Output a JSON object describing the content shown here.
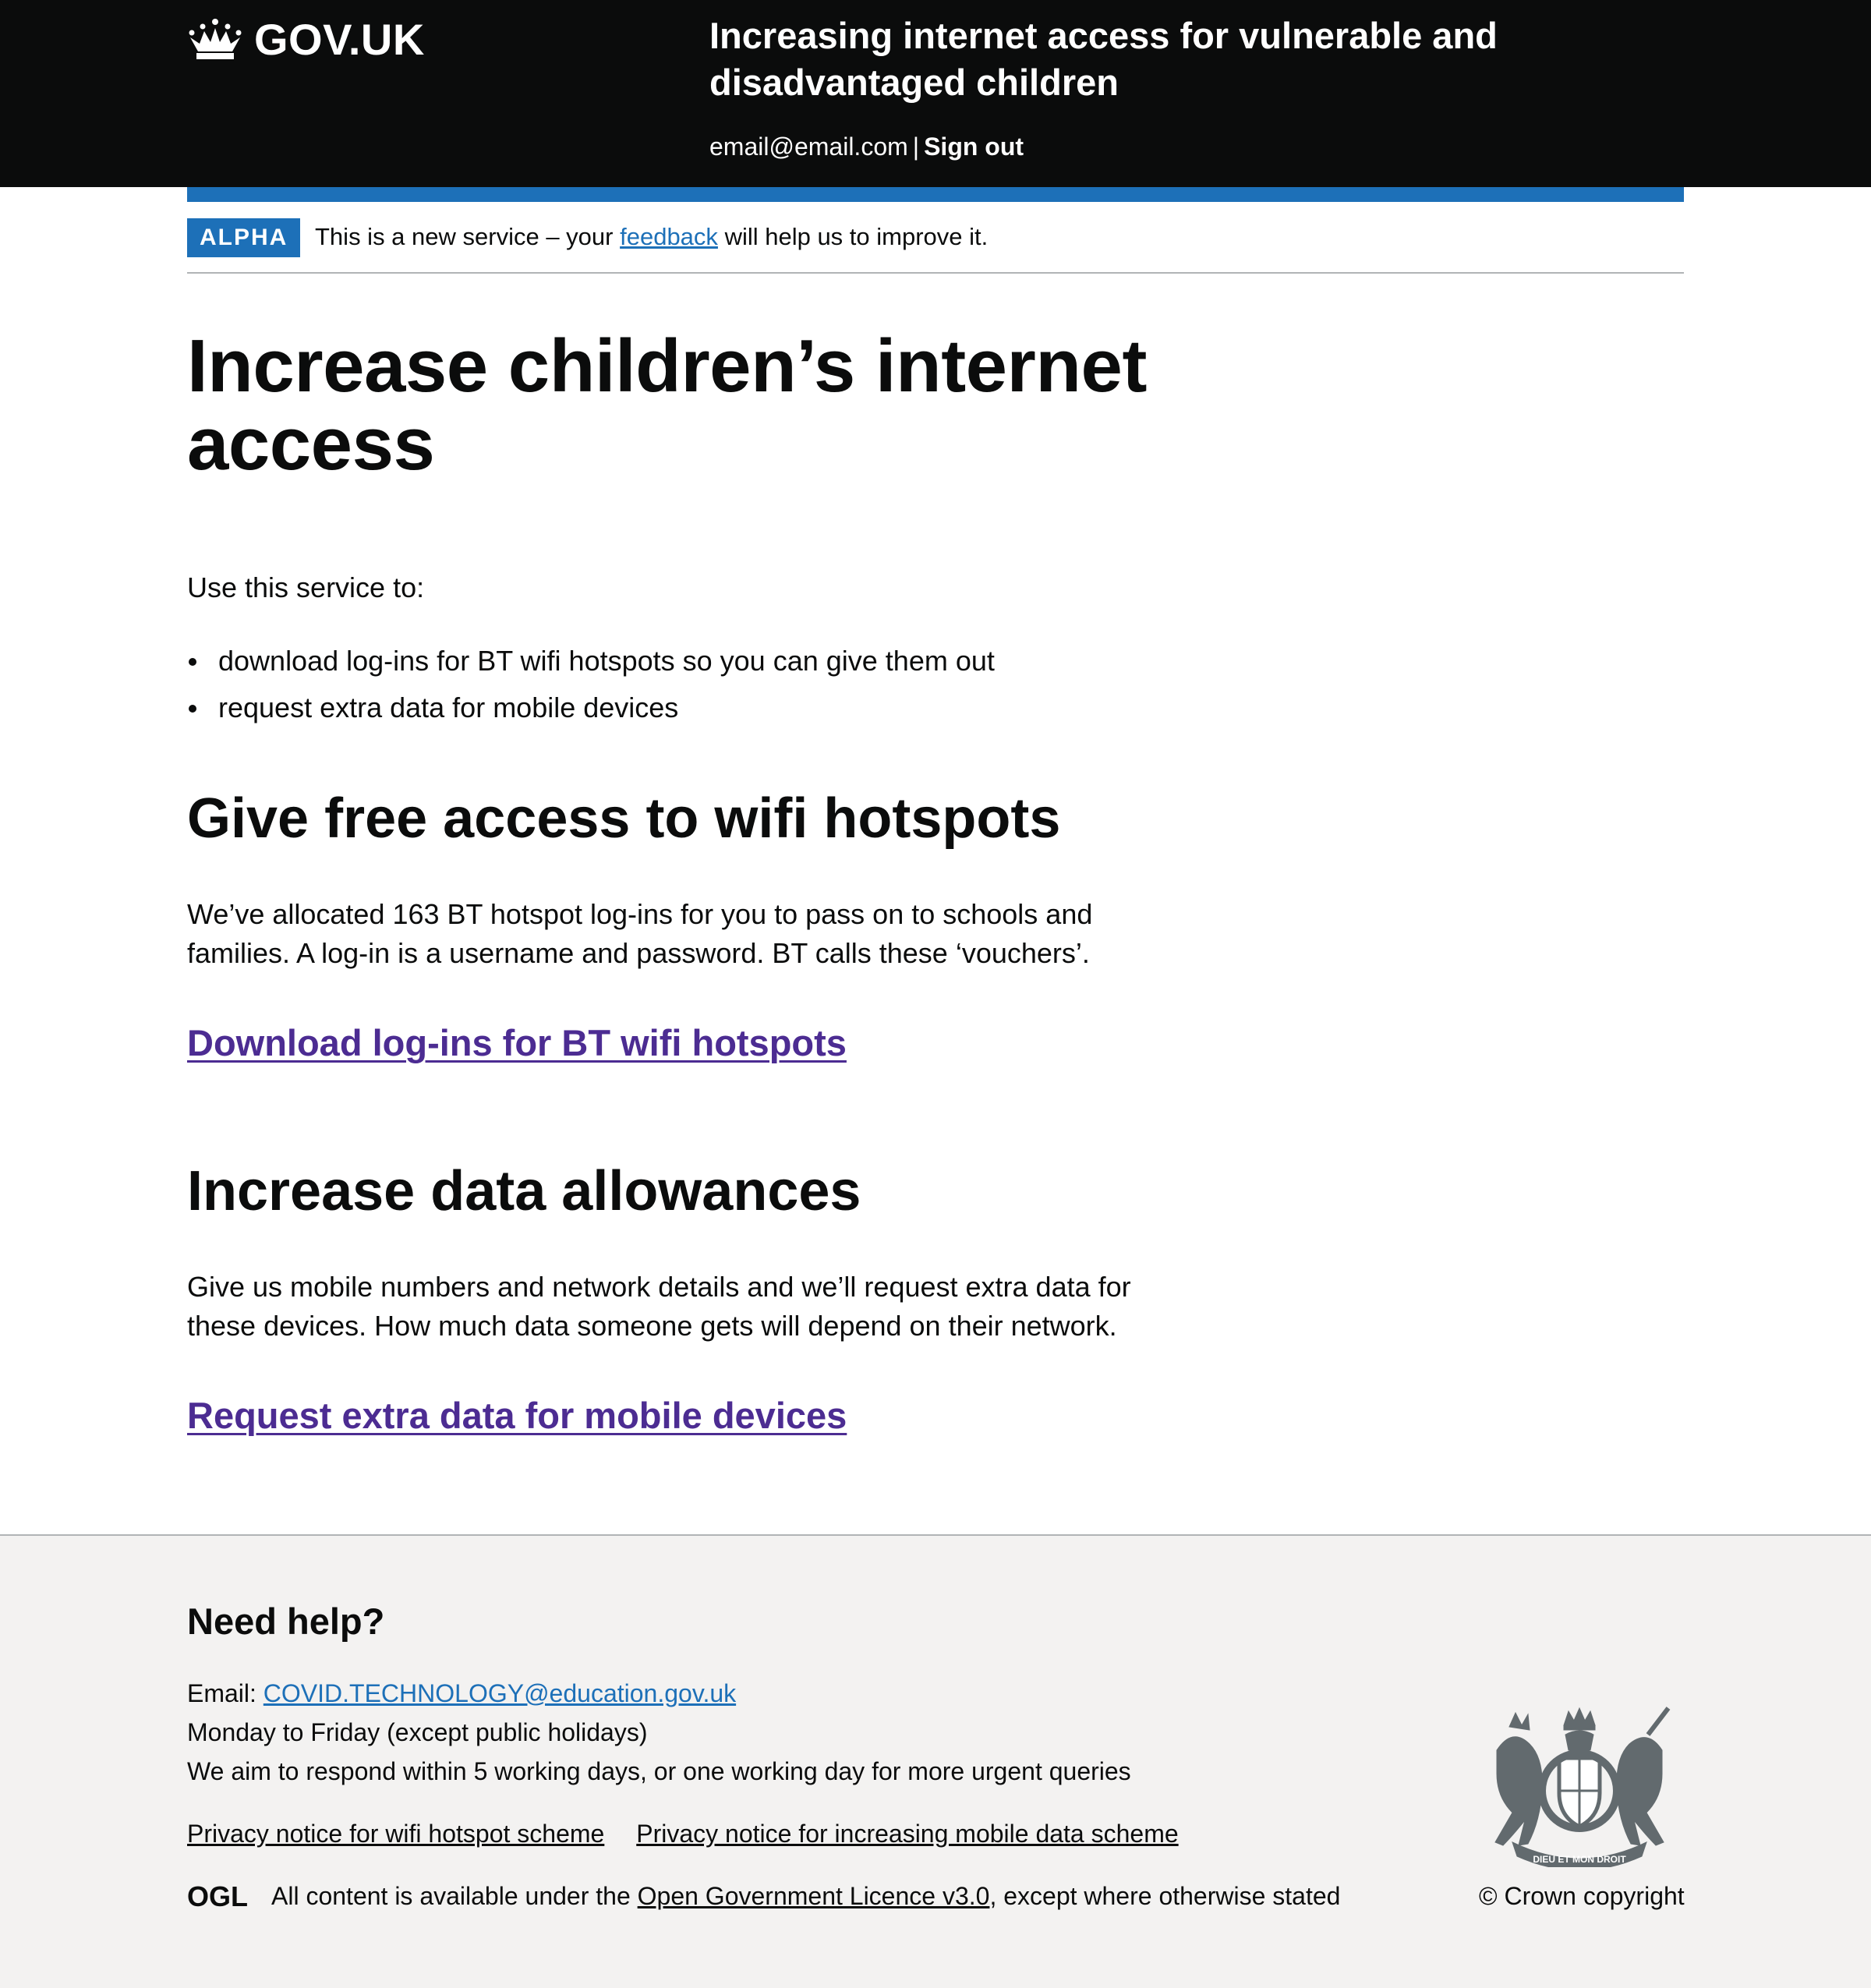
{
  "header": {
    "logo_text": "GOV.UK",
    "service_name": "Increasing internet access for vulnerable and disadvantaged children",
    "user_email": "email@email.com",
    "separator": "|",
    "sign_out": "Sign out"
  },
  "phase_banner": {
    "tag": "ALPHA",
    "text_before": "This is a new service – your",
    "link": "feedback",
    "text_after": "will help us to improve it."
  },
  "main": {
    "title": "Increase children’s internet access",
    "lead": "Use this service to:",
    "bullets": [
      "download log-ins for BT wifi hotspots so you can give them out",
      "request extra data for mobile devices"
    ],
    "wifi": {
      "heading": "Give free access to wifi hotspots",
      "body": "We’ve allocated 163 BT hotspot log-ins for you to pass on to schools and families. A log-in is a username and password. BT calls these ‘vouchers’.",
      "link": "Download log-ins for BT wifi hotspots"
    },
    "data": {
      "heading": "Increase data allowances",
      "body": "Give us mobile numbers and network details and we’ll request extra data for these devices. How much data someone gets will depend on their network.",
      "link": "Request extra data for mobile devices"
    }
  },
  "footer": {
    "heading": "Need help?",
    "email_label": "Email:",
    "email": "COVID.TECHNOLOGY@education.gov.uk",
    "hours": "Monday to Friday (except public holidays)",
    "response": "We aim to respond within 5 working days, or one working day for more urgent queries",
    "privacy_links": [
      "Privacy notice for wifi hotspot scheme",
      "Privacy notice for increasing mobile data scheme"
    ],
    "licence_before": "All content is available under the",
    "licence_link": "Open Government Licence v3.0",
    "licence_after": ", except where otherwise stated",
    "ogl_logo": "OGL",
    "crest_motto": "DIEU ET MON DROIT",
    "copyright": "© Crown copyright"
  },
  "colors": {
    "header_bg": "#0b0c0c",
    "brand_blue": "#1d70b8",
    "visited_link": "#4c2c92",
    "footer_bg": "#f3f2f1"
  },
  "icons": [
    "crown-icon",
    "ogl-logo-icon",
    "royal-coat-of-arms-icon"
  ]
}
